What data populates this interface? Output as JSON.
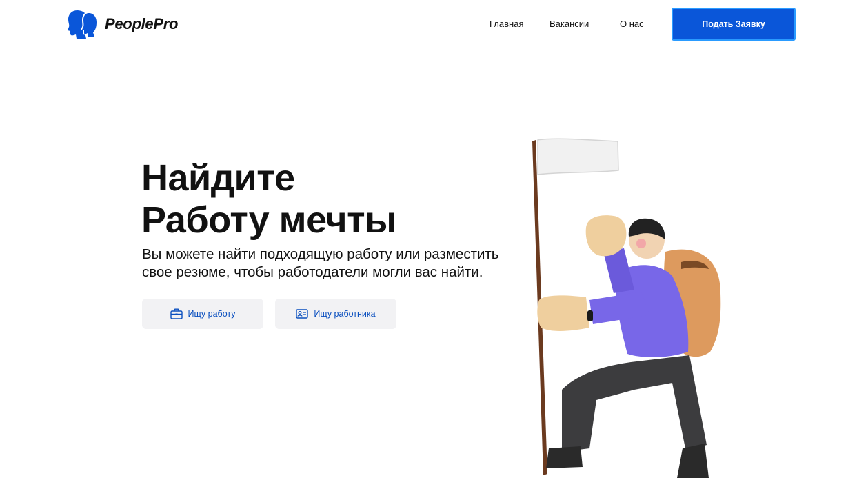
{
  "brand": {
    "name": "PeoplePro",
    "icon": "people-profile-logo-icon",
    "color": "#0a56d9"
  },
  "nav": {
    "items": [
      {
        "label": "Главная"
      },
      {
        "label": "Вакансии"
      },
      {
        "label": "О нас"
      }
    ],
    "cta_label": "Подать Заявку"
  },
  "hero": {
    "title_line1": "Найдите",
    "title_line2": "Работу мечты",
    "subtitle_line1": "Вы можете найти подходящую работу или разместить",
    "subtitle_line2": "свое резюме, чтобы работодатели могли вас найти.",
    "buttons": [
      {
        "label": "Ищу работу",
        "icon": "briefcase-icon"
      },
      {
        "label": "Ищу работника",
        "icon": "id-card-icon"
      }
    ]
  },
  "illustration": {
    "icon": "hiker-with-flag-illustration"
  },
  "colors": {
    "accent": "#0a56d9",
    "button_bg": "#f2f2f4",
    "link": "#0a4fbf"
  }
}
